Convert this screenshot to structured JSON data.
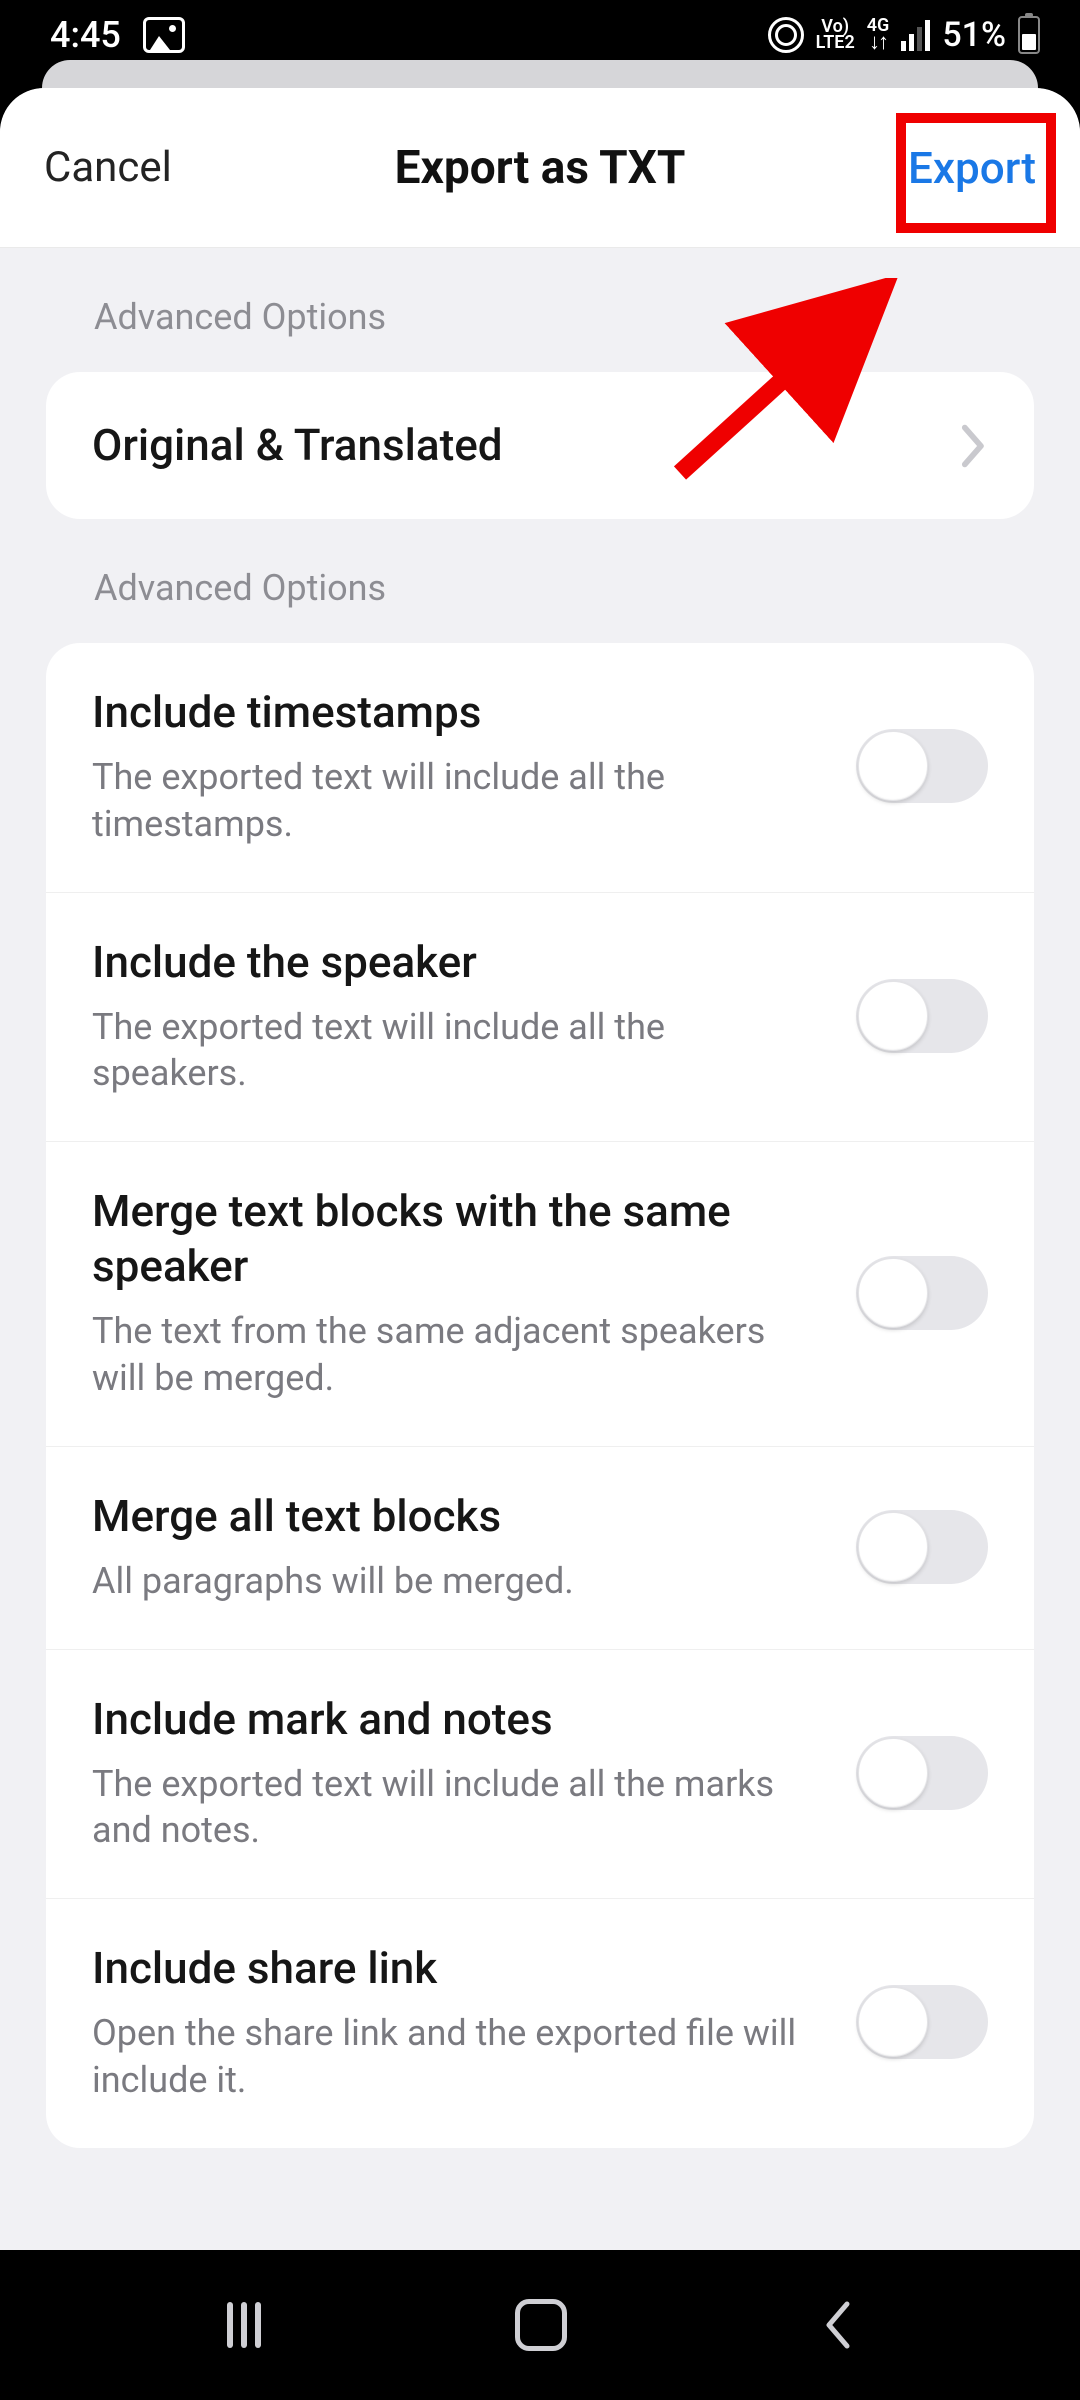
{
  "status": {
    "time": "4:45",
    "battery_pct": "51%",
    "lte_line1": "Vo)",
    "lte_line2": "LTE2",
    "net_line1": "4G",
    "net_arrows": "↓↑"
  },
  "header": {
    "cancel_label": "Cancel",
    "title": "Export as TXT",
    "export_label": "Export"
  },
  "section1_label": "Advanced Options",
  "mode_row": {
    "title": "Original & Translated"
  },
  "section2_label": "Advanced Options",
  "options": [
    {
      "title": "Include timestamps",
      "sub": "The exported text will include all the timestamps.",
      "on": false
    },
    {
      "title": "Include the speaker",
      "sub": "The exported text will include all the speakers.",
      "on": false
    },
    {
      "title": "Merge text blocks with the same speaker",
      "sub": "The text from the same adjacent speakers will be merged.",
      "on": false
    },
    {
      "title": "Merge all text blocks",
      "sub": "All paragraphs will be merged.",
      "on": false
    },
    {
      "title": "Include mark and notes",
      "sub": "The exported text will include all the marks and notes.",
      "on": false
    },
    {
      "title": "Include share link",
      "sub": "Open the share link and the exported file will include it.",
      "on": false
    }
  ],
  "annotation": {
    "highlight_color": "#ef0000",
    "accent_color": "#1a78e6"
  }
}
